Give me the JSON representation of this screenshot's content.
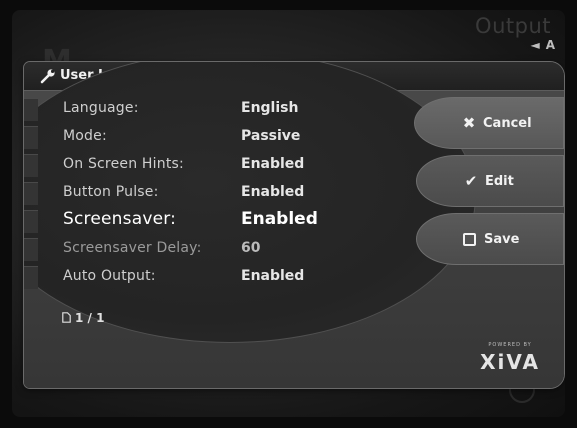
{
  "background": {
    "title": "Output",
    "audio_label": "A"
  },
  "dialog": {
    "title": "User Interface Settings",
    "rows": [
      {
        "label": "Language:",
        "value": "English"
      },
      {
        "label": "Mode:",
        "value": "Passive"
      },
      {
        "label": "On Screen Hints:",
        "value": "Enabled"
      },
      {
        "label": "Button Pulse:",
        "value": "Enabled"
      },
      {
        "label": "Screensaver:",
        "value": "Enabled"
      },
      {
        "label": "Screensaver Delay:",
        "value": "60"
      },
      {
        "label": "Auto Output:",
        "value": "Enabled"
      }
    ],
    "pager": "1 / 1"
  },
  "buttons": {
    "cancel": "Cancel",
    "edit": "Edit",
    "save": "Save"
  },
  "branding": {
    "powered_by": "POWERED BY",
    "logo": "XiVA"
  },
  "icons": {
    "title": "wrench-icon",
    "cancel": "x-icon",
    "edit": "checkmark-icon",
    "save": "square-icon",
    "pager": "page-icon",
    "audio": "speaker-icon"
  },
  "colors": {
    "panel": "#444444",
    "text": "#e6e6e6"
  }
}
